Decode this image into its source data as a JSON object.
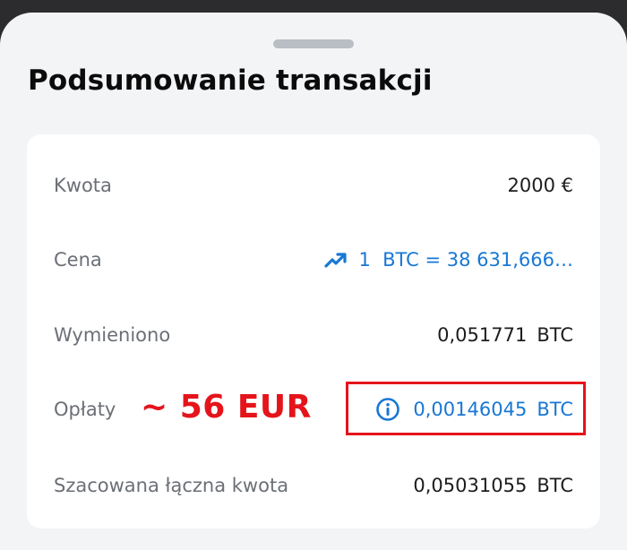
{
  "summary": {
    "title": "Podsumowanie transakcji",
    "rows": {
      "amount": {
        "label": "Kwota",
        "value": "2000 €"
      },
      "price": {
        "label": "Cena",
        "value": "1  BTC = 38 631,666…",
        "icon": "trending-up-icon"
      },
      "exchanged": {
        "label": "Wymieniono",
        "value": "0,051771",
        "unit": "BTC"
      },
      "fees": {
        "label": "Opłaty",
        "value": "0,00146045",
        "unit": "BTC",
        "icon": "info-icon"
      },
      "total": {
        "label": "Szacowana łączna kwota",
        "value": "0,05031055",
        "unit": "BTC"
      }
    }
  },
  "annotation": {
    "text": "~ 56 EUR"
  },
  "colors": {
    "background": "#f3f4f6",
    "card": "#ffffff",
    "link": "#1877d4",
    "annotation": "#e5141b",
    "label": "#6b6f76"
  }
}
